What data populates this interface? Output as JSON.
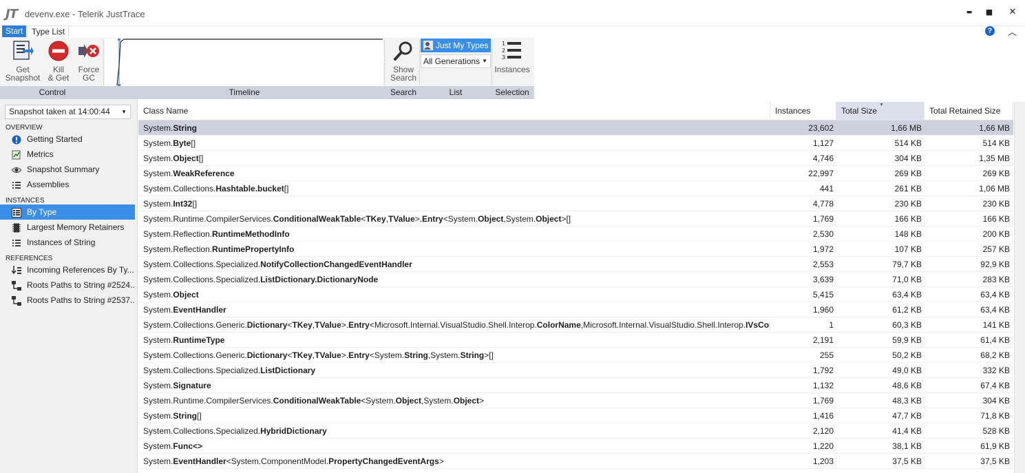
{
  "window": {
    "logo": "JT",
    "title": "devenv.exe - Telerik JustTrace",
    "minimize": "▬",
    "maximize": "■",
    "close": "✕"
  },
  "menu": {
    "tabs": [
      "Start",
      "Type List"
    ],
    "help": "?",
    "collapse": "︿"
  },
  "ribbon": {
    "groups": {
      "control": "Control",
      "timeline": "Timeline",
      "search": "Search",
      "list": "List",
      "selection": "Selection"
    },
    "buttons": {
      "get_snapshot": [
        "Get",
        "Snapshot"
      ],
      "kill_get": [
        "Kill",
        "& Get"
      ],
      "force_gc": [
        "Force",
        "GC"
      ],
      "show_search": [
        "Show",
        "Search"
      ],
      "instances": "Instances"
    },
    "just_my_types": "Just My Types",
    "generations": "All Generations"
  },
  "sidebar": {
    "snapshot_selector": "Snapshot taken at 14:00:44",
    "sections": {
      "overview": {
        "title": "OVERVIEW",
        "items": [
          "Getting Started",
          "Metrics",
          "Snapshot Summary",
          "Assemblies"
        ]
      },
      "instances": {
        "title": "INSTANCES",
        "items": [
          "By Type",
          "Largest Memory Retainers",
          "Instances of String"
        ]
      },
      "references": {
        "title": "REFERENCES",
        "items": [
          "Incoming References By Ty...",
          "Roots Paths to String #2524...",
          "Roots Paths to String #2537..."
        ]
      }
    }
  },
  "table": {
    "columns": [
      "Class Name",
      "Instances",
      "Total Size",
      "Total Retained Size"
    ],
    "sorted_column": "Total Size",
    "rows": [
      {
        "name": [
          [
            "System.",
            0
          ],
          [
            "String",
            1
          ]
        ],
        "instances": "23,602",
        "size": "1,66 MB",
        "retained": "1,66 MB"
      },
      {
        "name": [
          [
            "System.",
            0
          ],
          [
            "Byte",
            1
          ],
          [
            "[]",
            0
          ]
        ],
        "instances": "1,127",
        "size": "514 KB",
        "retained": "514 KB"
      },
      {
        "name": [
          [
            "System.",
            0
          ],
          [
            "Object",
            1
          ],
          [
            "[]",
            0
          ]
        ],
        "instances": "4,746",
        "size": "304 KB",
        "retained": "1,35 MB"
      },
      {
        "name": [
          [
            "System.",
            0
          ],
          [
            "WeakReference",
            1
          ]
        ],
        "instances": "22,997",
        "size": "269 KB",
        "retained": "269 KB"
      },
      {
        "name": [
          [
            "System.Collections.",
            0
          ],
          [
            "Hashtable.bucket",
            1
          ],
          [
            "[]",
            0
          ]
        ],
        "instances": "441",
        "size": "261 KB",
        "retained": "1,06 MB"
      },
      {
        "name": [
          [
            "System.",
            0
          ],
          [
            "Int32",
            1
          ],
          [
            "[]",
            0
          ]
        ],
        "instances": "4,778",
        "size": "230 KB",
        "retained": "230 KB"
      },
      {
        "name": [
          [
            "System.Runtime.CompilerServices.",
            0
          ],
          [
            "ConditionalWeakTable",
            1
          ],
          [
            "<",
            0
          ],
          [
            "TKey",
            1
          ],
          [
            ",",
            0
          ],
          [
            "TValue",
            1
          ],
          [
            ">.",
            0
          ],
          [
            "Entry",
            1
          ],
          [
            "<System.",
            0
          ],
          [
            "Object",
            1
          ],
          [
            ",System.",
            0
          ],
          [
            "Object",
            1
          ],
          [
            ">[]",
            0
          ]
        ],
        "instances": "1,769",
        "size": "166 KB",
        "retained": "166 KB"
      },
      {
        "name": [
          [
            "System.Reflection.",
            0
          ],
          [
            "RuntimeMethodInfo",
            1
          ]
        ],
        "instances": "2,530",
        "size": "148 KB",
        "retained": "200 KB"
      },
      {
        "name": [
          [
            "System.Reflection.",
            0
          ],
          [
            "RuntimePropertyInfo",
            1
          ]
        ],
        "instances": "1,972",
        "size": "107 KB",
        "retained": "257 KB"
      },
      {
        "name": [
          [
            "System.Collections.Specialized.",
            0
          ],
          [
            "NotifyCollectionChangedEventHandler",
            1
          ]
        ],
        "instances": "2,553",
        "size": "79,7 KB",
        "retained": "92,9 KB"
      },
      {
        "name": [
          [
            "System.Collections.Specialized.",
            0
          ],
          [
            "ListDictionary.DictionaryNode",
            1
          ]
        ],
        "instances": "3,639",
        "size": "71,0 KB",
        "retained": "283 KB"
      },
      {
        "name": [
          [
            "System.",
            0
          ],
          [
            "Object",
            1
          ]
        ],
        "instances": "5,415",
        "size": "63,4 KB",
        "retained": "63,4 KB"
      },
      {
        "name": [
          [
            "System.",
            0
          ],
          [
            "EventHandler",
            1
          ]
        ],
        "instances": "1,960",
        "size": "61,2 KB",
        "retained": "63,4 KB"
      },
      {
        "name": [
          [
            "System.Collections.Generic.",
            0
          ],
          [
            "Dictionary",
            1
          ],
          [
            "<",
            0
          ],
          [
            "TKey",
            1
          ],
          [
            ",",
            0
          ],
          [
            "TValue",
            1
          ],
          [
            ">.",
            0
          ],
          [
            "Entry",
            1
          ],
          [
            "<Microsoft.Internal.VisualStudio.Shell.Interop.",
            0
          ],
          [
            "ColorName",
            1
          ],
          [
            ",Microsoft.Internal.VisualStudio.Shell.Interop.",
            0
          ],
          [
            "IVsColorI",
            1
          ]
        ],
        "instances": "1",
        "size": "60,3 KB",
        "retained": "141 KB"
      },
      {
        "name": [
          [
            "System.",
            0
          ],
          [
            "RuntimeType",
            1
          ]
        ],
        "instances": "2,191",
        "size": "59,9 KB",
        "retained": "61,4 KB"
      },
      {
        "name": [
          [
            "System.Collections.Generic.",
            0
          ],
          [
            "Dictionary",
            1
          ],
          [
            "<",
            0
          ],
          [
            "TKey",
            1
          ],
          [
            ",",
            0
          ],
          [
            "TValue",
            1
          ],
          [
            ">.",
            0
          ],
          [
            "Entry",
            1
          ],
          [
            "<System.",
            0
          ],
          [
            "String",
            1
          ],
          [
            ",System.",
            0
          ],
          [
            "String",
            1
          ],
          [
            ">[]",
            0
          ]
        ],
        "instances": "255",
        "size": "50,2 KB",
        "retained": "68,2 KB"
      },
      {
        "name": [
          [
            "System.Collections.Specialized.",
            0
          ],
          [
            "ListDictionary",
            1
          ]
        ],
        "instances": "1,792",
        "size": "49,0 KB",
        "retained": "332 KB"
      },
      {
        "name": [
          [
            "System.",
            0
          ],
          [
            "Signature",
            1
          ]
        ],
        "instances": "1,132",
        "size": "48,6 KB",
        "retained": "67,4 KB"
      },
      {
        "name": [
          [
            "System.Runtime.CompilerServices.",
            0
          ],
          [
            "ConditionalWeakTable",
            1
          ],
          [
            "<System.",
            0
          ],
          [
            "Object",
            1
          ],
          [
            ",System.",
            0
          ],
          [
            "Object",
            1
          ],
          [
            ">",
            0
          ]
        ],
        "instances": "1,769",
        "size": "48,3 KB",
        "retained": "304 KB"
      },
      {
        "name": [
          [
            "System.",
            0
          ],
          [
            "String",
            1
          ],
          [
            "[]",
            0
          ]
        ],
        "instances": "1,416",
        "size": "47,7 KB",
        "retained": "71,8 KB"
      },
      {
        "name": [
          [
            "System.Collections.Specialized.",
            0
          ],
          [
            "HybridDictionary",
            1
          ]
        ],
        "instances": "2,120",
        "size": "41,4 KB",
        "retained": "528 KB"
      },
      {
        "name": [
          [
            "System.",
            0
          ],
          [
            "Func<>",
            1
          ]
        ],
        "instances": "1,220",
        "size": "38,1 KB",
        "retained": "61,9 KB"
      },
      {
        "name": [
          [
            "System.",
            0
          ],
          [
            "EventHandler",
            1
          ],
          [
            "<System.ComponentModel.",
            0
          ],
          [
            "PropertyChangedEventArgs",
            1
          ],
          [
            ">",
            0
          ]
        ],
        "instances": "1,203",
        "size": "37,5 KB",
        "retained": "37,5 KB"
      }
    ]
  },
  "colors": {
    "accent": "#3a8ee6",
    "selected_row": "#cdd1dd",
    "ribbon_group_bar": "#cdd2dc"
  }
}
